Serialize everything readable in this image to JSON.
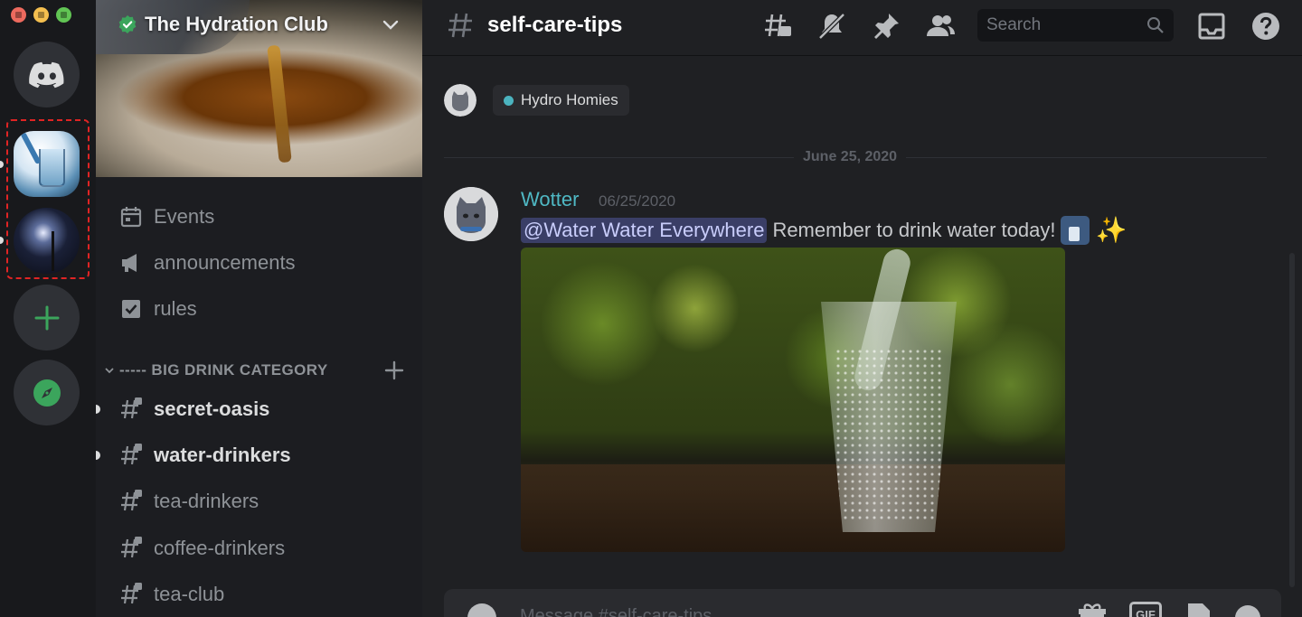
{
  "window": {
    "buttons": [
      "close",
      "minimize",
      "maximize"
    ]
  },
  "servers": {
    "items": [
      {
        "name": "home",
        "icon": "discord-logo-icon"
      },
      {
        "name": "water-server",
        "icon": "water-glass-image"
      },
      {
        "name": "night-server",
        "icon": "night-sky-image"
      },
      {
        "name": "add-server",
        "icon": "plus-icon"
      },
      {
        "name": "explore",
        "icon": "compass-icon"
      }
    ],
    "highlight_color": "#e02424"
  },
  "server": {
    "name": "The Hydration Club",
    "verified": true
  },
  "sidebar": {
    "events_label": "Events",
    "channels_top": [
      {
        "name": "announcements",
        "icon": "megaphone-icon"
      },
      {
        "name": "rules",
        "icon": "checkbox-icon"
      }
    ],
    "category": {
      "name": "----- BIG DRINK CATEGORY"
    },
    "channels": [
      {
        "name": "secret-oasis",
        "unread": true,
        "locked": true
      },
      {
        "name": "water-drinkers",
        "unread": true,
        "locked": true
      },
      {
        "name": "tea-drinkers",
        "unread": false,
        "locked": true
      },
      {
        "name": "coffee-drinkers",
        "unread": false,
        "locked": true
      },
      {
        "name": "tea-club",
        "unread": false,
        "locked": true
      }
    ]
  },
  "header": {
    "channel_name": "self-care-tips",
    "icons": [
      "threads-icon",
      "mute-bell-icon",
      "pin-icon",
      "members-icon",
      "inbox-icon",
      "help-icon"
    ],
    "search_placeholder": "Search"
  },
  "messages": {
    "role_chip": "Hydro Homies",
    "role_color": "#4bb3bf",
    "date_divider": "June 25, 2020",
    "post": {
      "author": "Wotter",
      "author_color": "#4fb8c4",
      "timestamp": "06/25/2020",
      "mention": "@Water Water Everywhere",
      "text": "Remember to drink water today!",
      "emojis": [
        "potable-water-emoji",
        "sparkles-emoji"
      ],
      "sparkle": "✨",
      "attachment": "water-glass-photo"
    }
  },
  "composer": {
    "placeholder": "Message #self-care-tips",
    "icons": [
      "gift-icon",
      "gif-icon",
      "sticker-icon",
      "emoji-icon"
    ],
    "gif_label": "GIF"
  }
}
